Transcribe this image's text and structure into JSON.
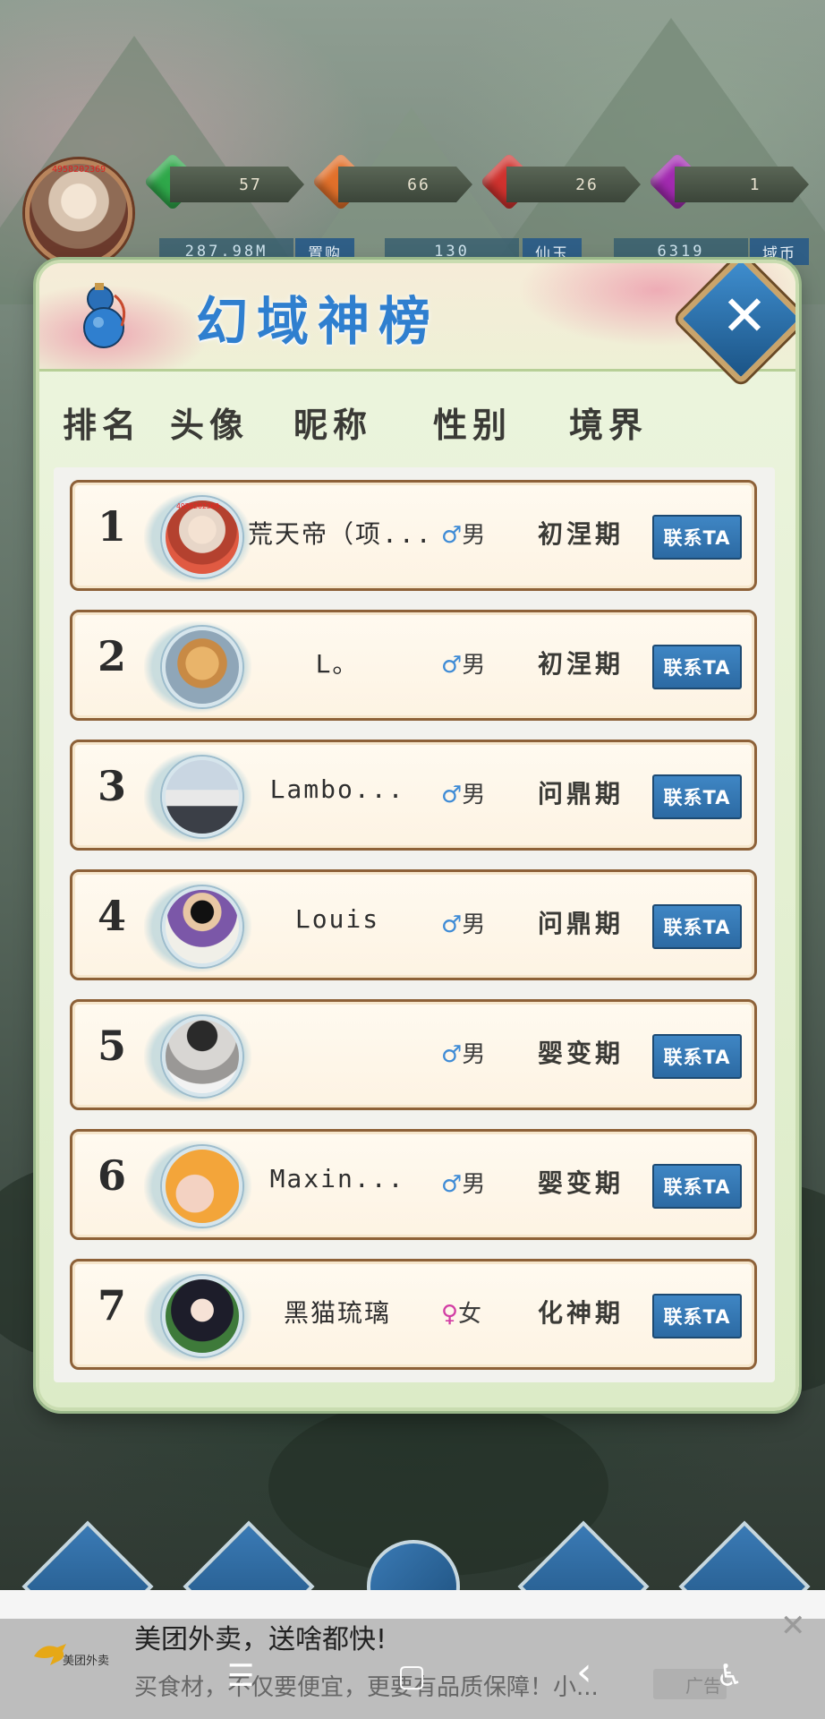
{
  "hud": {
    "player_id": "4958202369",
    "resources": [
      {
        "icon": "green-gem-icon",
        "value": "57",
        "color": "#2fa84a"
      },
      {
        "icon": "orange-gem-icon",
        "value": "66",
        "color": "#e2702a"
      },
      {
        "icon": "red-gem-icon",
        "value": "26",
        "color": "#d0322e"
      },
      {
        "icon": "purple-gem-icon",
        "value": "1",
        "color": "#a22ab0"
      }
    ],
    "currencies": [
      {
        "value": "287.98M",
        "tag": "置购"
      },
      {
        "value": "130",
        "tag": "仙玉"
      },
      {
        "value": "6319",
        "tag": "域币"
      }
    ]
  },
  "panel": {
    "title": "幻域神榜",
    "headers": [
      "排名",
      "头像",
      "昵称",
      "性别",
      "境界"
    ],
    "rows": [
      {
        "rank": "1",
        "nickname": "荒天帝（项...",
        "gender_symbol": "♂",
        "gender": "男",
        "realm": "初涅期",
        "contact": "联系TA",
        "avatar_id": "4958202369"
      },
      {
        "rank": "2",
        "nickname": "L。",
        "gender_symbol": "♂",
        "gender": "男",
        "realm": "初涅期",
        "contact": "联系TA"
      },
      {
        "rank": "3",
        "nickname": "Lambo...",
        "gender_symbol": "♂",
        "gender": "男",
        "realm": "问鼎期",
        "contact": "联系TA"
      },
      {
        "rank": "4",
        "nickname": "Louis",
        "gender_symbol": "♂",
        "gender": "男",
        "realm": "问鼎期",
        "contact": "联系TA"
      },
      {
        "rank": "5",
        "nickname": "",
        "gender_symbol": "♂",
        "gender": "男",
        "realm": "婴变期",
        "contact": "联系TA"
      },
      {
        "rank": "6",
        "nickname": "Maxin...",
        "gender_symbol": "♂",
        "gender": "男",
        "realm": "婴变期",
        "contact": "联系TA"
      },
      {
        "rank": "7",
        "nickname": "黑猫琉璃",
        "gender_symbol": "♀",
        "gender": "女",
        "realm": "化神期",
        "contact": "联系TA"
      }
    ]
  },
  "ad": {
    "brand": "美团外卖",
    "title": "美团外卖，送啥都快!",
    "description": "买食材，不仅要便宜，更要有品质保障！小...",
    "label": "广告"
  },
  "system_nav": {
    "menu": "☰",
    "home": "▢",
    "back": "‹",
    "accessibility": "♿"
  },
  "colors": {
    "title_blue": "#2f7fcf",
    "contact_button": "#2c6aa3",
    "male": "#3e8bd6",
    "female": "#d23da4",
    "row_border": "#8d6138"
  }
}
